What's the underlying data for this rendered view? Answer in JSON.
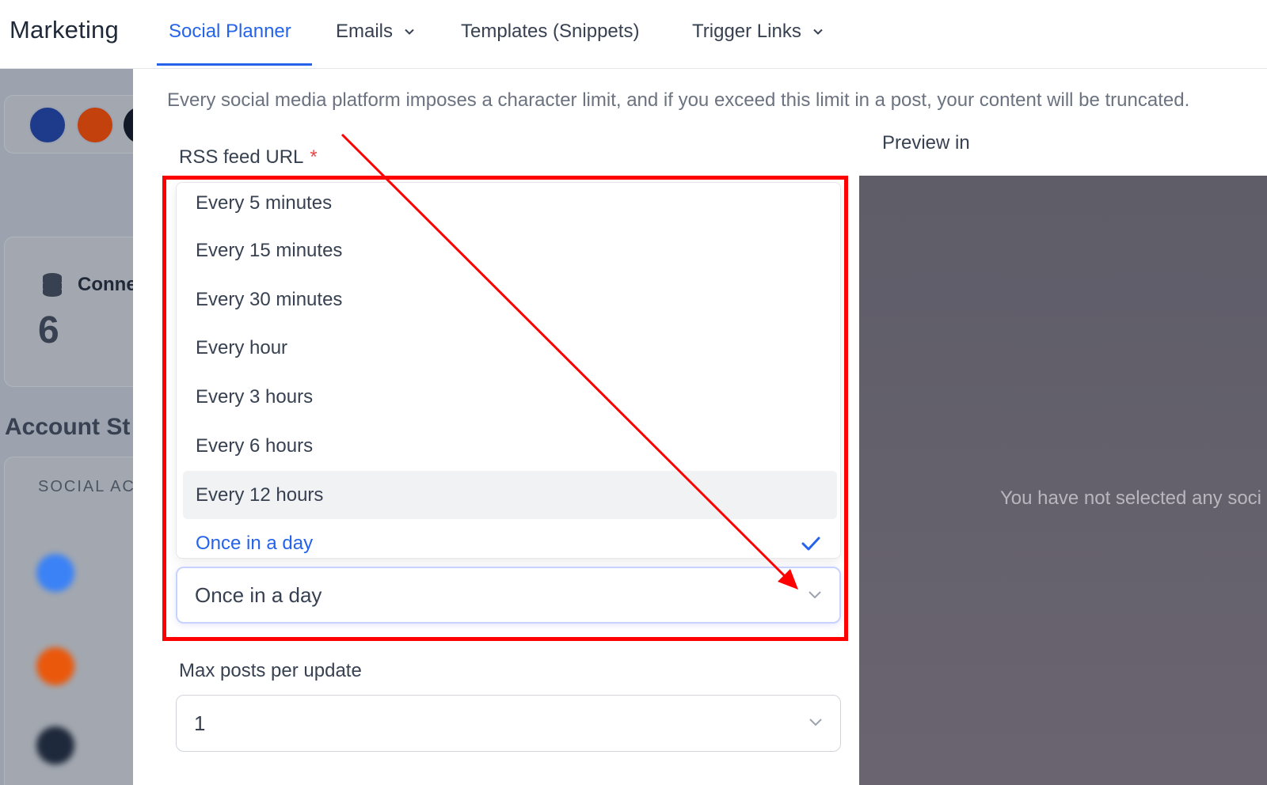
{
  "topnav": {
    "app_title": "Marketing",
    "tabs": [
      {
        "label": "Social Planner",
        "active": true,
        "has_dropdown": false
      },
      {
        "label": "Emails",
        "active": false,
        "has_dropdown": true
      },
      {
        "label": "Templates (Snippets)",
        "active": false,
        "has_dropdown": false
      },
      {
        "label": "Trigger Links",
        "active": false,
        "has_dropdown": true
      }
    ]
  },
  "background": {
    "stat_label": "Conne",
    "stat_value": "6",
    "section_title": "Account St",
    "table_header": "SOCIAL AC"
  },
  "drawer": {
    "notice": "Every social media platform imposes a character limit, and if you exceed this limit in a post, your content will be truncated.",
    "rss_label": "RSS feed URL",
    "required_mark": "*",
    "frequency_options": [
      "Every 5 minutes",
      "Every 15 minutes",
      "Every 30 minutes",
      "Every hour",
      "Every 3 hours",
      "Every 6 hours",
      "Every 12 hours",
      "Once in a day"
    ],
    "hovered_option": "Every 12 hours",
    "selected_frequency": "Once in a day",
    "max_posts_label": "Max posts per update",
    "max_posts_value": "1"
  },
  "preview": {
    "label": "Preview in",
    "empty_message": "You have not selected any soci"
  },
  "colors": {
    "accent": "#2563eb",
    "annotation": "#ff0000",
    "preview_bg": "#5e5d68"
  }
}
